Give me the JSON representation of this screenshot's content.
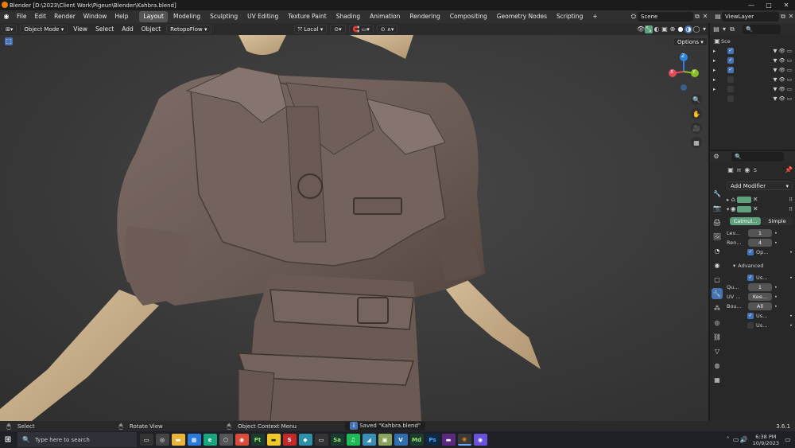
{
  "window": {
    "title": "Blender [D:\\2023\\Client Work\\Pigeun\\Blender\\Kahbra.blend]",
    "minimize": "—",
    "maximize": "▢",
    "close": "✕"
  },
  "menu": {
    "items": [
      "File",
      "Edit",
      "Render",
      "Window",
      "Help"
    ],
    "workspaces": [
      "Layout",
      "Modeling",
      "Sculpting",
      "UV Editing",
      "Texture Paint",
      "Shading",
      "Animation",
      "Rendering",
      "Compositing",
      "Geometry Nodes",
      "Scripting"
    ],
    "active_workspace": "Layout",
    "add_workspace": "+",
    "scene_label": "Scene",
    "viewlayer_label": "ViewLayer"
  },
  "viewport_header": {
    "mode": "Object Mode",
    "view": "View",
    "select": "Select",
    "add": "Add",
    "object": "Object",
    "addon": "RetopoFlow",
    "transform_orientation": "Local",
    "options": "Options"
  },
  "gizmo": {
    "z": "Z",
    "y": "Y",
    "x": "X"
  },
  "outliner": {
    "root_label": "Sce",
    "search_placeholder": ""
  },
  "properties": {
    "search_placeholder": "",
    "object_name": "H",
    "data_name": "S",
    "add_modifier": "Add Modifier",
    "subdiv_tabs": [
      "Catmul...",
      "Simple"
    ],
    "active_subdiv_tab": "Catmul...",
    "fields": {
      "levels_label": "Lev...",
      "levels_value": "1",
      "render_label": "Ren...",
      "render_value": "4",
      "optimal_label": "Op...",
      "advanced_label": "Advanced",
      "use_label_1": "Us...",
      "quality_label": "Qu...",
      "quality_value": "1",
      "uv_label": "UV ...",
      "uv_value": "Kee...",
      "boundary_label": "Bou...",
      "boundary_value": "All",
      "use_label_2": "Us...",
      "use_label_3": "Us..."
    }
  },
  "statusbar": {
    "select": "Select",
    "rotate": "Rotate View",
    "context": "Object Context Menu",
    "saved": "Saved \"Kahbra.blend\"",
    "version": "3.6.1"
  },
  "taskbar": {
    "search_placeholder": "Type here to search",
    "time": "6:38 PM",
    "date": "10/9/2023"
  },
  "colors": {
    "accent_blue": "#4772b3",
    "active_green": "#5fa17c",
    "viewport_bg": "#3c3c3c",
    "model_fabric": "#6f605a",
    "model_skin": "#c9b08a"
  }
}
